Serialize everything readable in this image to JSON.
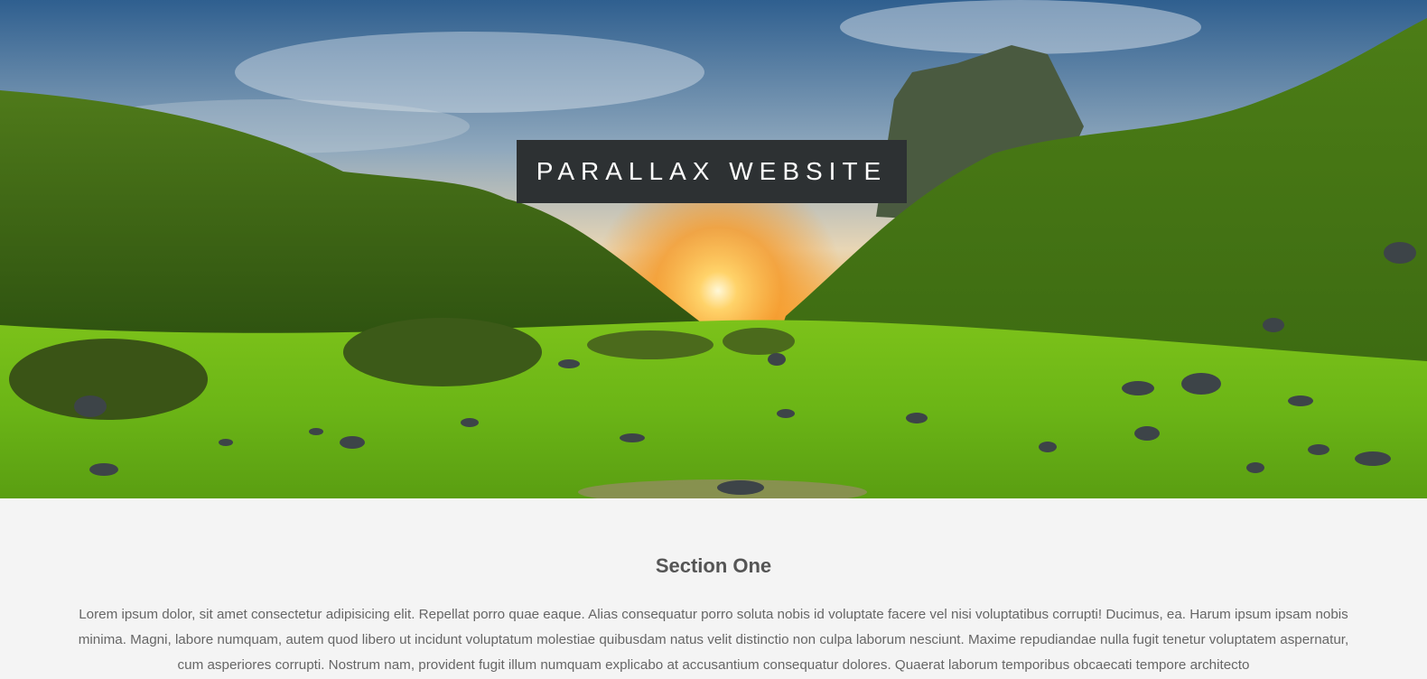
{
  "hero": {
    "title": "PARALLAX WEBSITE",
    "image": "valley-sunset-landscape"
  },
  "section_one": {
    "heading": "Section One",
    "body": "Lorem ipsum dolor, sit amet consectetur adipisicing elit. Repellat porro quae eaque. Alias consequatur porro soluta nobis id voluptate facere vel nisi voluptatibus corrupti! Ducimus, ea. Harum ipsum ipsam nobis minima. Magni, labore numquam, autem quod libero ut incidunt voluptatum molestiae quibusdam natus velit distinctio non culpa laborum nesciunt. Maxime repudiandae nulla fugit tenetur voluptatem aspernatur, cum asperiores corrupti. Nostrum nam, provident fugit illum numquam explicabo at accusantium consequatur dolores. Quaerat laborum temporibus obcaecati tempore architecto"
  },
  "colors": {
    "title_box": "#2d3133",
    "section_bg": "#f4f4f4",
    "heading_text": "#555555",
    "body_text": "#666666"
  }
}
